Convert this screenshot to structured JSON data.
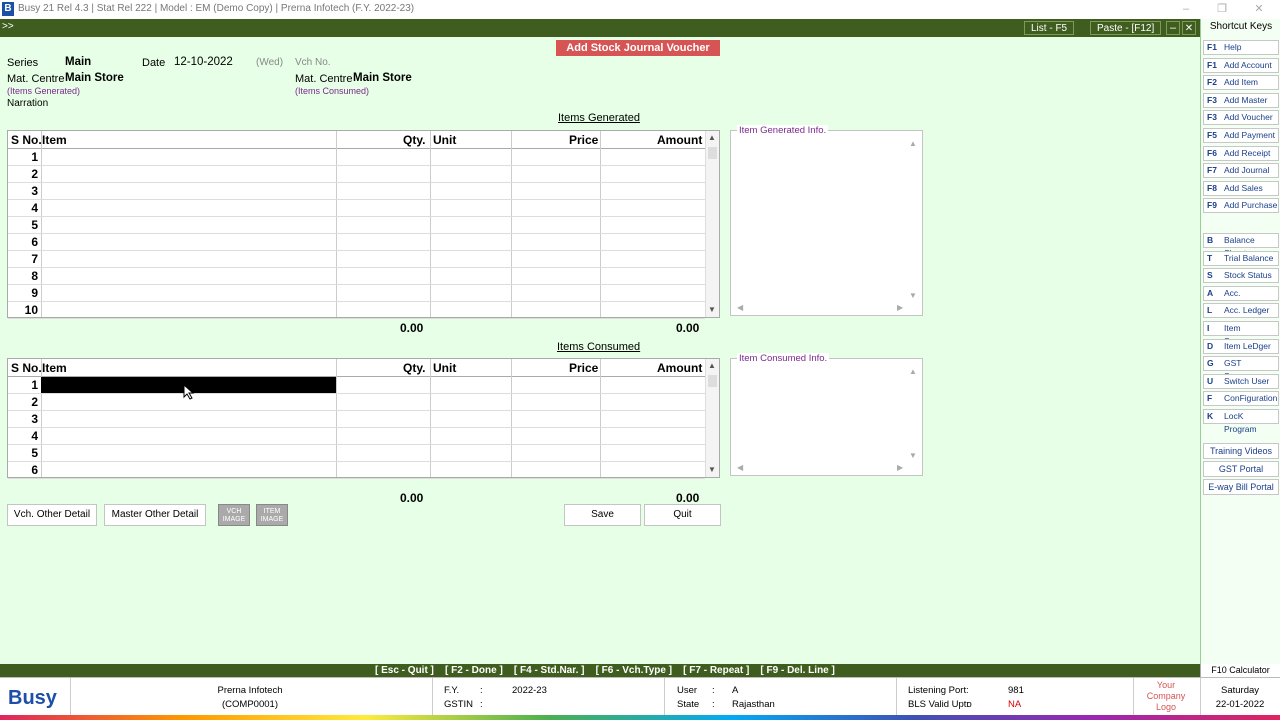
{
  "titlebar": {
    "logo": "B",
    "title": "Busy 21  Rel 4.3  |  Stat Rel 222  |  Model : EM (Demo Copy)  |  Prerna Infotech  (F.Y. 2022-23)"
  },
  "menubar": {
    "collapse": ">>",
    "list": "List - F5",
    "paste": "Paste - [F12]"
  },
  "voucher": {
    "title": "Add Stock Journal Voucher",
    "series_label": "Series",
    "series_value": "Main",
    "date_label": "Date",
    "date_value": "12-10-2022",
    "day": "(Wed)",
    "vch_no_label": "Vch No.",
    "matcentre_label": "Mat. Centre",
    "matcentre_gen": "Main Store",
    "gen_sub": "(Items Generated)",
    "matcentre_cons": "Main Store",
    "cons_sub": "(Items Consumed)",
    "narration_label": "Narration"
  },
  "grid_headers": {
    "sno": "S No.",
    "item": "Item",
    "qty": "Qty.",
    "unit": "Unit",
    "price": "Price",
    "amount": "Amount"
  },
  "generated": {
    "title": "Items Generated",
    "rows": [
      "1",
      "2",
      "3",
      "4",
      "5",
      "6",
      "7",
      "8",
      "9",
      "10"
    ],
    "total_qty": "0.00",
    "total_amount": "0.00",
    "info_title": "Item Generated Info."
  },
  "consumed": {
    "title": "Items Consumed",
    "rows": [
      "1",
      "2",
      "3",
      "4",
      "5",
      "6"
    ],
    "total_qty": "0.00",
    "total_amount": "0.00",
    "info_title": "Item Consumed Info."
  },
  "buttons": {
    "vch_other": "Vch. Other Detail",
    "master_other": "Master Other Detail",
    "vch_image": "VCH IMAGE",
    "item_image": "ITEM IMAGE",
    "save": "Save",
    "quit": "Quit"
  },
  "shortcuts": {
    "title": "Shortcut Keys",
    "fkeys": [
      {
        "k": "F1",
        "l": "Help"
      },
      {
        "k": "F1",
        "l": "Add Account"
      },
      {
        "k": "F2",
        "l": "Add Item"
      },
      {
        "k": "F3",
        "l": "Add Master"
      },
      {
        "k": "F3",
        "l": "Add Voucher"
      },
      {
        "k": "F5",
        "l": "Add Payment"
      },
      {
        "k": "F6",
        "l": "Add Receipt"
      },
      {
        "k": "F7",
        "l": "Add Journal"
      },
      {
        "k": "F8",
        "l": "Add Sales"
      },
      {
        "k": "F9",
        "l": "Add Purchase"
      }
    ],
    "letters": [
      {
        "k": "B",
        "l": "Balance Sheet"
      },
      {
        "k": "T",
        "l": "Trial Balance"
      },
      {
        "k": "S",
        "l": "Stock Status"
      },
      {
        "k": "A",
        "l": "Acc. Summary"
      },
      {
        "k": "L",
        "l": "Acc. Ledger"
      },
      {
        "k": "I",
        "l": "Item Summary"
      },
      {
        "k": "D",
        "l": "Item LeDger"
      },
      {
        "k": "G",
        "l": "GST Summary"
      },
      {
        "k": "U",
        "l": "Switch User"
      },
      {
        "k": "F",
        "l": "ConFiguration"
      },
      {
        "k": "K",
        "l": "LocK Program"
      }
    ],
    "extra": [
      "Training Videos",
      "GST Portal",
      "E-way Bill Portal"
    ],
    "calc": "F10 Calculator"
  },
  "keybar": "[ Esc - Quit ]    [ F2 - Done ]    [ F4 - Std.Nar. ]    [ F6 - Vch.Type ]    [ F7 - Repeat ]    [ F9 - Del. Line ]",
  "footer": {
    "brand": "Busy",
    "company": "Prerna Infotech",
    "company_code": "(COMP0001)",
    "fy_label": "F.Y.",
    "fy_sep": ":",
    "fy_value": "2022-23",
    "gstin_label": "GSTIN",
    "gstin_sep": ":",
    "user_label": "User",
    "user_sep": ":",
    "user_value": "A",
    "state_label": "State",
    "state_sep": ":",
    "state_value": "Rajasthan",
    "port_label": "Listening Port",
    "port_sep": ":",
    "port_value": "981",
    "bls_label": "BLS Valid Upto",
    "bls_sep": ":",
    "bls_value": "NA",
    "logo_l1": "Your",
    "logo_l2": "Company",
    "logo_l3": "Logo",
    "day": "Saturday",
    "date": "22-01-2022"
  },
  "colors": {
    "bg": "#e6ffe6",
    "menubar": "#3f5d1e",
    "title_red": "#d65454",
    "purple": "#7b2a8c",
    "brand_blue": "#1b4fa8"
  }
}
